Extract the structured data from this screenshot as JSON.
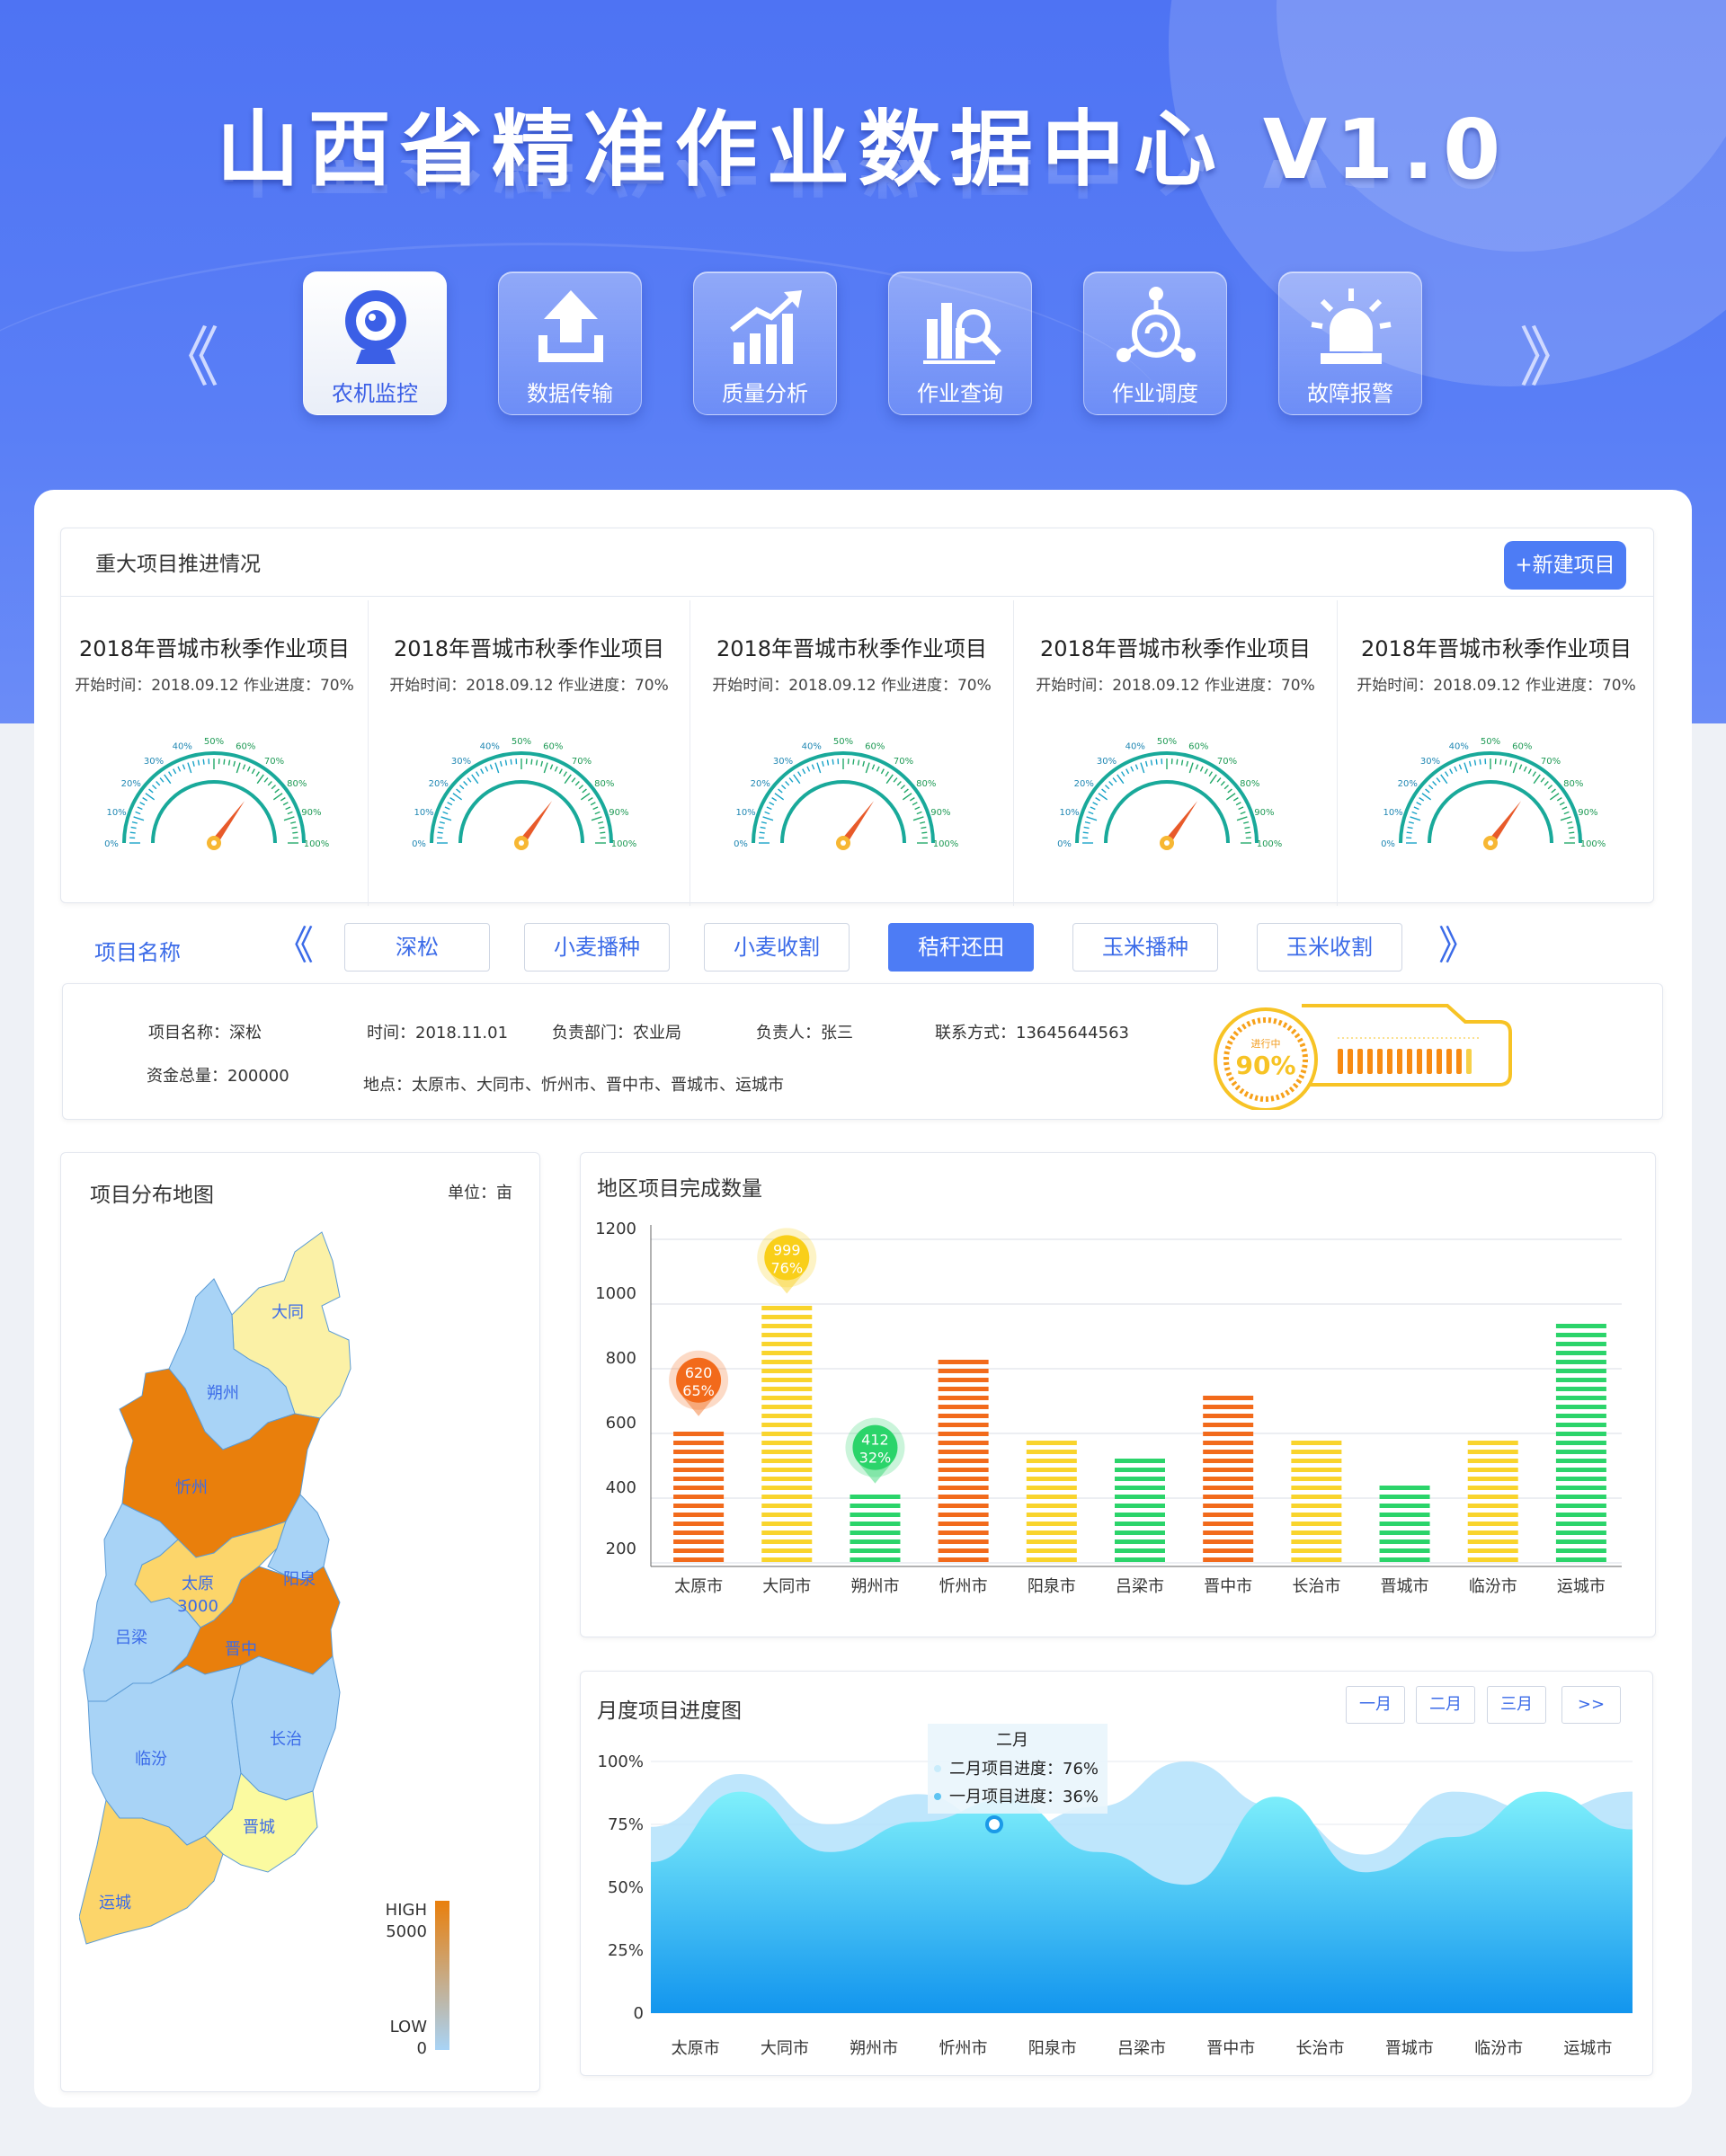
{
  "header": {
    "title": "山西省精准作业数据中心 V1.0",
    "nav_prev": "《",
    "nav_next": "》",
    "nav_items": [
      {
        "label": "农机监控",
        "icon": "webcam-icon",
        "active": true
      },
      {
        "label": "数据传输",
        "icon": "upload-icon",
        "active": false
      },
      {
        "label": "质量分析",
        "icon": "trend-chart-icon",
        "active": false
      },
      {
        "label": "作业查询",
        "icon": "chart-search-icon",
        "active": false
      },
      {
        "label": "作业调度",
        "icon": "dispatch-network-icon",
        "active": false
      },
      {
        "label": "故障报警",
        "icon": "alarm-siren-icon",
        "active": false
      }
    ]
  },
  "projects": {
    "title": "重大项目推进情况",
    "new_button": "+新建项目",
    "gauge_ticks": [
      "0%",
      "10%",
      "20%",
      "30%",
      "40%",
      "50%",
      "60%",
      "70%",
      "80%",
      "90%",
      "100%"
    ],
    "items": [
      {
        "name": "2018年晋城市秋季作业项目",
        "info": "开始时间：2018.09.12 作业进度：70%",
        "progress": 0.7
      },
      {
        "name": "2018年晋城市秋季作业项目",
        "info": "开始时间：2018.09.12 作业进度：70%",
        "progress": 0.7
      },
      {
        "name": "2018年晋城市秋季作业项目",
        "info": "开始时间：2018.09.12 作业进度：70%",
        "progress": 0.7
      },
      {
        "name": "2018年晋城市秋季作业项目",
        "info": "开始时间：2018.09.12 作业进度：70%",
        "progress": 0.7
      },
      {
        "name": "2018年晋城市秋季作业项目",
        "info": "开始时间：2018.09.12 作业进度：70%",
        "progress": 0.7
      }
    ]
  },
  "tabs": {
    "label": "项目名称",
    "prev": "《",
    "next": "》",
    "items": [
      {
        "label": "深松",
        "active": false
      },
      {
        "label": "小麦播种",
        "active": false
      },
      {
        "label": "小麦收割",
        "active": false
      },
      {
        "label": "秸秆还田",
        "active": true
      },
      {
        "label": "玉米播种",
        "active": false
      },
      {
        "label": "玉米收割",
        "active": false
      }
    ]
  },
  "detail": {
    "name": "项目名称：深松",
    "time": "时间：2018.11.01",
    "dept": "负责部门：农业局",
    "owner": "负责人：张三",
    "contact": "联系方式：13645644563",
    "funds": "资金总量：200000",
    "location": "地点：太原市、大同市、忻州市、晋中市、晋城市、运城市",
    "status_label": "进行中",
    "status_value": "90%",
    "progress": 0.9
  },
  "map": {
    "title": "项目分布地图",
    "unit": "单位：亩",
    "legend_high": "HIGH",
    "legend_high_value": "5000",
    "legend_low": "LOW",
    "legend_low_value": "0",
    "regions": [
      {
        "name": "大同",
        "color": "#fbf1a6"
      },
      {
        "name": "朔州",
        "color": "#a8d3f6"
      },
      {
        "name": "忻州",
        "color": "#e97f0c"
      },
      {
        "name": "太原",
        "color": "#fcd56a",
        "value": "3000"
      },
      {
        "name": "阳泉",
        "color": "#a8d3f6"
      },
      {
        "name": "吕梁",
        "color": "#a8d3f6"
      },
      {
        "name": "晋中",
        "color": "#e97f0c"
      },
      {
        "name": "临汾",
        "color": "#a8d3f6"
      },
      {
        "name": "长治",
        "color": "#a8d3f6"
      },
      {
        "name": "晋城",
        "color": "#fbfaa0"
      },
      {
        "name": "运城",
        "color": "#fcd56a"
      }
    ]
  },
  "bar_chart": {
    "title": "地区项目完成数量",
    "chart_data": {
      "type": "bar",
      "categories": [
        "太原市",
        "大同市",
        "朔州市",
        "忻州市",
        "阳泉市",
        "吕梁市",
        "晋中市",
        "长治市",
        "晋城市",
        "临汾市",
        "运城市"
      ],
      "values": [
        620,
        999,
        412,
        840,
        590,
        530,
        730,
        580,
        460,
        590,
        940
      ],
      "colors": [
        "#f26a1b",
        "#f9d42c",
        "#2bd46a",
        "#f26a1b",
        "#f9d42c",
        "#2bd46a",
        "#f26a1b",
        "#f9d42c",
        "#2bd46a",
        "#f9d42c",
        "#2bd46a"
      ],
      "yticks": [
        "200",
        "400",
        "600",
        "800",
        "1000",
        "1200"
      ],
      "ylim": [
        200,
        1200
      ],
      "pins": [
        {
          "index": 0,
          "value": "620",
          "percent": "65%",
          "color": "#f26a1b"
        },
        {
          "index": 1,
          "value": "999",
          "percent": "76%",
          "color": "#f9cf19"
        },
        {
          "index": 2,
          "value": "412",
          "percent": "32%",
          "color": "#2bd46a"
        }
      ]
    }
  },
  "area_chart": {
    "title": "月度项目进度图",
    "buttons": [
      "一月",
      "二月",
      "三月",
      ">>"
    ],
    "tooltip": {
      "title": "二月",
      "line1": "二月项目进度：76%",
      "line2": "一月项目进度：36%"
    },
    "chart_data": {
      "type": "area",
      "categories": [
        "太原市",
        "大同市",
        "朔州市",
        "忻州市",
        "阳泉市",
        "吕梁市",
        "晋中市",
        "长治市",
        "晋城市",
        "临汾市",
        "运城市"
      ],
      "yticks": [
        "0",
        "25%",
        "50%",
        "75%",
        "100%"
      ],
      "ylim": [
        0,
        100
      ],
      "series": [
        {
          "name": "二月",
          "color": "#b3e2fb",
          "values": [
            74,
            95,
            75,
            87,
            72,
            82,
            100,
            82,
            63,
            88,
            80,
            88
          ]
        },
        {
          "name": "一月",
          "color": "#31a8ef",
          "values": [
            60,
            88,
            64,
            76,
            85,
            64,
            51,
            86,
            56,
            70,
            88,
            73
          ]
        }
      ]
    }
  }
}
